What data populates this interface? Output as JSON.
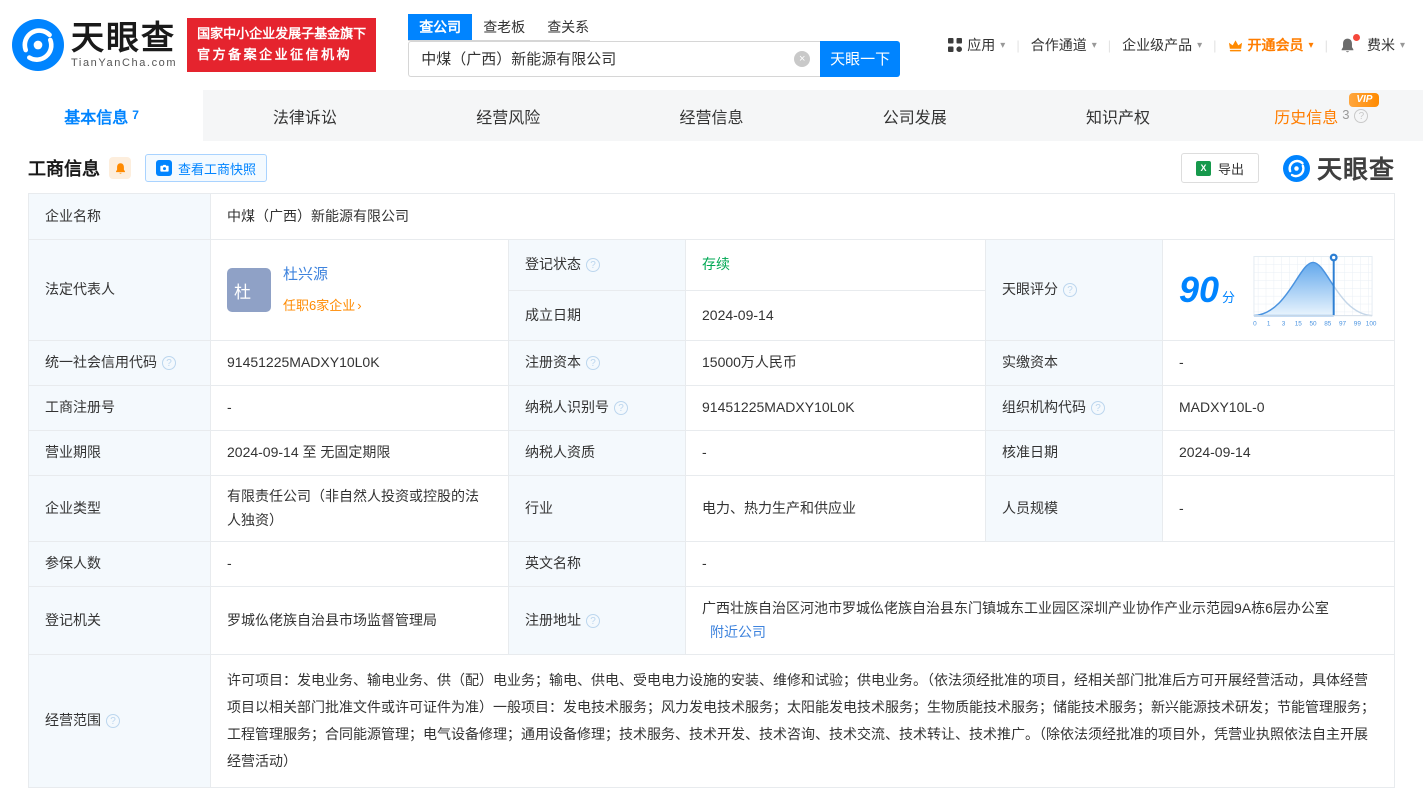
{
  "colors": {
    "brand_blue": "#0084ff",
    "link_blue": "#3e83dd",
    "orange": "#ff7d00",
    "green": "#00a854",
    "badge_red": "#e5242e",
    "label_bg": "#f4f9fd"
  },
  "header": {
    "logo": {
      "title": "天眼查",
      "subtitle": "TianYanCha.com"
    },
    "badge": {
      "line1": "国家中小企业发展子基金旗下",
      "line2": "官方备案企业征信机构"
    },
    "search": {
      "tabs": [
        "查公司",
        "查老板",
        "查关系"
      ],
      "value": "中煤（广西）新能源有限公司",
      "button": "天眼一下"
    },
    "nav": {
      "apps": "应用",
      "coop": "合作通道",
      "enterprise": "企业级产品",
      "vip": "开通会员",
      "user": "费米"
    }
  },
  "tabs": [
    {
      "label": "基本信息",
      "count": "7"
    },
    {
      "label": "法律诉讼"
    },
    {
      "label": "经营风险"
    },
    {
      "label": "经营信息"
    },
    {
      "label": "公司发展"
    },
    {
      "label": "知识产权"
    },
    {
      "label": "历史信息",
      "count": "3",
      "vip": "VIP"
    }
  ],
  "section": {
    "title": "工商信息",
    "snapshot": "查看工商快照",
    "export": "导出",
    "watermark": "天眼查"
  },
  "score": {
    "value": "90",
    "unit": "分",
    "ticks": [
      "0",
      "1",
      "3",
      "15",
      "50",
      "85",
      "97",
      "99",
      "100"
    ]
  },
  "biz": {
    "company_name": {
      "label": "企业名称",
      "value": "中煤（广西）新能源有限公司"
    },
    "legal_rep": {
      "label": "法定代表人",
      "avatar": "杜",
      "name": "杜兴源",
      "positions": "任职6家企业"
    },
    "reg_status": {
      "label": "登记状态",
      "value": "存续"
    },
    "establish_date": {
      "label": "成立日期",
      "value": "2024-09-14"
    },
    "score_label": "天眼评分",
    "credit_code": {
      "label": "统一社会信用代码",
      "value": "91451225MADXY10L0K"
    },
    "reg_capital": {
      "label": "注册资本",
      "value": "15000万人民币"
    },
    "paid_capital": {
      "label": "实缴资本",
      "value": "-"
    },
    "reg_number": {
      "label": "工商注册号",
      "value": "-"
    },
    "taxpayer_id": {
      "label": "纳税人识别号",
      "value": "91451225MADXY10L0K"
    },
    "org_code": {
      "label": "组织机构代码",
      "value": "MADXY10L-0"
    },
    "business_term": {
      "label": "营业期限",
      "value": "2024-09-14 至 无固定期限"
    },
    "taxpayer_quality": {
      "label": "纳税人资质",
      "value": "-"
    },
    "approval_date": {
      "label": "核准日期",
      "value": "2024-09-14"
    },
    "company_type": {
      "label": "企业类型",
      "value": "有限责任公司（非自然人投资或控股的法人独资）"
    },
    "industry": {
      "label": "行业",
      "value": "电力、热力生产和供应业"
    },
    "staff_size": {
      "label": "人员规模",
      "value": "-"
    },
    "insured_count": {
      "label": "参保人数",
      "value": "-"
    },
    "english_name": {
      "label": "英文名称",
      "value": "-"
    },
    "reg_authority": {
      "label": "登记机关",
      "value": "罗城仫佬族自治县市场监督管理局"
    },
    "reg_address": {
      "label": "注册地址",
      "value": "广西壮族自治区河池市罗城仫佬族自治县东门镇城东工业园区深圳产业协作产业示范园9A栋6层办公室",
      "nearby": "附近公司"
    },
    "business_scope": {
      "label": "经营范围",
      "value": "许可项目：发电业务、输电业务、供（配）电业务；输电、供电、受电电力设施的安装、维修和试验；供电业务。（依法须经批准的项目，经相关部门批准后方可开展经营活动，具体经营项目以相关部门批准文件或许可证件为准）一般项目：发电技术服务；风力发电技术服务；太阳能发电技术服务；生物质能技术服务；储能技术服务；新兴能源技术研发；节能管理服务；工程管理服务；合同能源管理；电气设备修理；通用设备修理；技术服务、技术开发、技术咨询、技术交流、技术转让、技术推广。（除依法须经批准的项目外，凭营业执照依法自主开展经营活动）"
    }
  }
}
